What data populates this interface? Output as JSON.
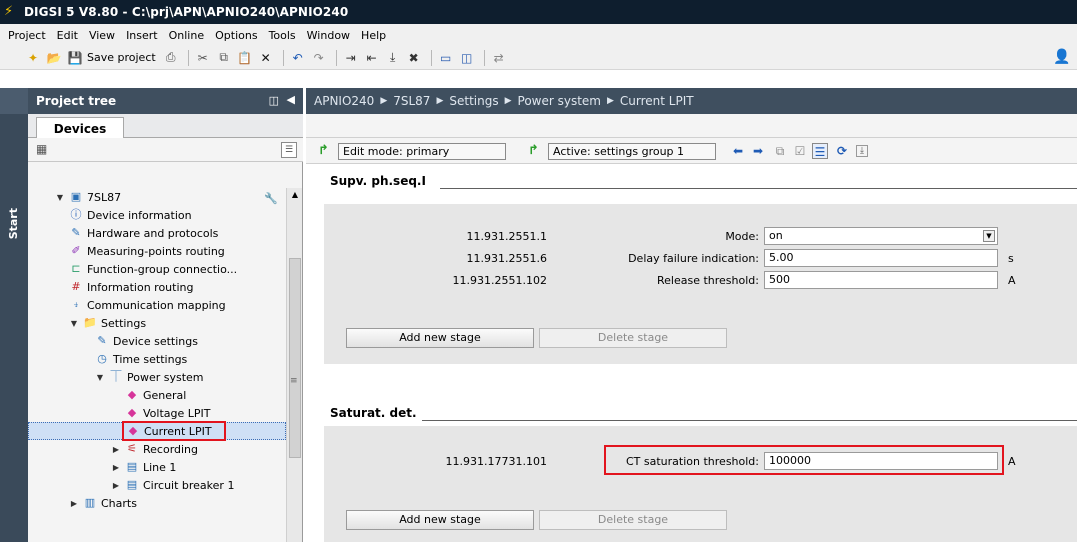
{
  "window": {
    "title": "DIGSI 5 V8.80 - C:\\prj\\APN\\APNIO240\\APNIO240"
  },
  "menu": [
    "Project",
    "Edit",
    "View",
    "Insert",
    "Online",
    "Options",
    "Tools",
    "Window",
    "Help"
  ],
  "toolbar": {
    "save_label": "Save project"
  },
  "start_strip": {
    "label": "Start"
  },
  "tree": {
    "header": "Project tree",
    "tab": "Devices",
    "items": [
      {
        "label": "7SL87"
      },
      {
        "label": "Device information"
      },
      {
        "label": "Hardware and protocols"
      },
      {
        "label": "Measuring-points routing"
      },
      {
        "label": "Function-group connectio..."
      },
      {
        "label": "Information routing"
      },
      {
        "label": "Communication mapping"
      },
      {
        "label": "Settings"
      },
      {
        "label": "Device settings"
      },
      {
        "label": "Time settings"
      },
      {
        "label": "Power system"
      },
      {
        "label": "General"
      },
      {
        "label": "Voltage LPIT"
      },
      {
        "label": "Current LPIT"
      },
      {
        "label": "Recording"
      },
      {
        "label": "Line 1"
      },
      {
        "label": "Circuit breaker 1"
      },
      {
        "label": "Charts"
      }
    ]
  },
  "breadcrumb": [
    "APNIO240",
    "7SL87",
    "Settings",
    "Power system",
    "Current LPIT"
  ],
  "main_toolbar": {
    "edit_mode": "Edit mode: primary",
    "active_group": "Active: settings group 1"
  },
  "groups": {
    "supv": {
      "title": "Supv. ph.seq.I",
      "rows": [
        {
          "id": "11.931.2551.1",
          "label": "Mode:",
          "value": "on",
          "unit": ""
        },
        {
          "id": "11.931.2551.6",
          "label": "Delay failure indication:",
          "value": "5.00",
          "unit": "s"
        },
        {
          "id": "11.931.2551.102",
          "label": "Release threshold:",
          "value": "500",
          "unit": "A"
        }
      ],
      "add_label": "Add new stage",
      "delete_label": "Delete stage"
    },
    "sat": {
      "title": "Saturat. det.",
      "rows": [
        {
          "id": "11.931.17731.101",
          "label": "CT saturation threshold:",
          "value": "100000",
          "unit": "A"
        }
      ],
      "add_label": "Add new stage",
      "delete_label": "Delete stage"
    }
  },
  "colors": {
    "highlight": "#e2141e",
    "header_bg": "#3f4f5f",
    "title_bg": "#0e1e2e"
  }
}
